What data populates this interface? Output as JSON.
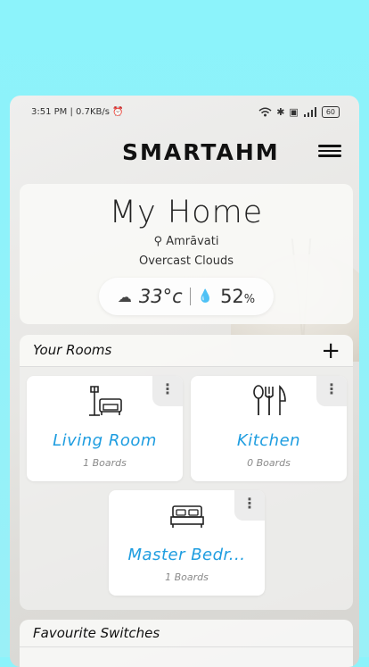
{
  "status_bar": {
    "time": "3:51 PM",
    "speed": "0.7KB/s",
    "battery": "60"
  },
  "header": {
    "logo": "SMARTAHM"
  },
  "home": {
    "title": "My Home",
    "location": "Amrāvati",
    "condition": "Overcast Clouds",
    "temperature": "33°c",
    "humidity": "52",
    "humidity_unit": "%"
  },
  "rooms": {
    "title": "Your Rooms",
    "add_label": "+",
    "items": [
      {
        "name": "Living Room",
        "boards": "1 Boards",
        "icon": "sofa-lamp-icon"
      },
      {
        "name": "Kitchen",
        "boards": "0 Boards",
        "icon": "cutlery-icon"
      },
      {
        "name": "Master Bedr...",
        "boards": "1 Boards",
        "icon": "bed-icon"
      }
    ]
  },
  "favourites": {
    "title": "Favourite Switches"
  },
  "colors": {
    "accent": "#1e9de0",
    "background": "#8ef2fa"
  }
}
